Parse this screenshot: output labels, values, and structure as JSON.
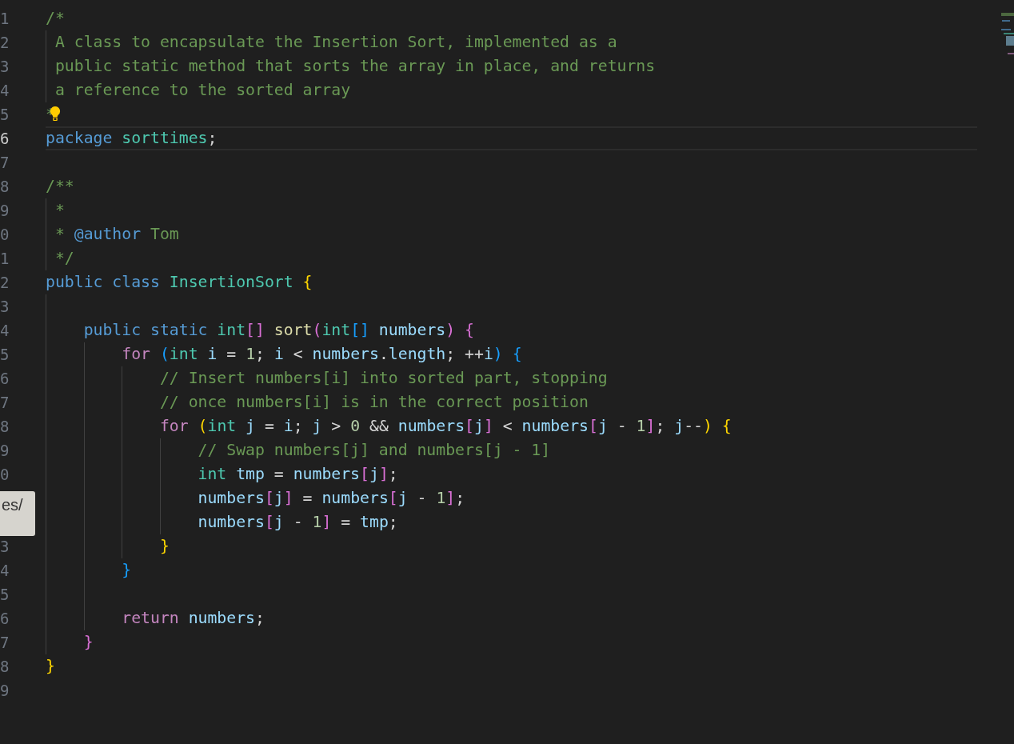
{
  "editor": {
    "lines": [
      {
        "number": "1",
        "current": false,
        "tokens": [
          {
            "kind": "comment",
            "text": "/*"
          }
        ],
        "children": [
          {
            "number": "2",
            "current": false,
            "tokens": [
              {
                "kind": "comment",
                "text": "A class to encapsulate the Insertion Sort, implemented as a"
              }
            ]
          },
          {
            "number": "3",
            "current": false,
            "tokens": [
              {
                "kind": "comment",
                "text": "public static method that sorts the array in place, and returns"
              }
            ]
          },
          {
            "number": "4",
            "current": false,
            "tokens": [
              {
                "kind": "comment",
                "text": "a reference to the sorted array"
              }
            ]
          }
        ]
      },
      {
        "number": "5",
        "current": false,
        "lightbulb": true,
        "tokens": [
          {
            "kind": "comment",
            "text": "*"
          }
        ]
      },
      {
        "number": "6",
        "current": true,
        "tokens": [
          {
            "kind": "keyword",
            "text": "package "
          },
          {
            "kind": "type",
            "text": "sorttimes"
          },
          {
            "kind": "plain",
            "text": ";"
          }
        ]
      },
      {
        "number": "7",
        "current": false
      },
      {
        "number": "8",
        "current": false,
        "tokens": [
          {
            "kind": "comment",
            "text": "/**"
          }
        ],
        "children": [
          {
            "number": "9",
            "current": false,
            "tokens": [
              {
                "kind": "comment",
                "text": "*"
              }
            ]
          },
          {
            "number": "0",
            "current": false,
            "tokens": [
              {
                "kind": "comment",
                "text": "* "
              },
              {
                "kind": "keyword",
                "text": "@author"
              },
              {
                "kind": "comment",
                "text": " Tom"
              }
            ]
          },
          {
            "number": "1",
            "current": false,
            "tokens": [
              {
                "kind": "comment",
                "text": "*/"
              }
            ]
          }
        ]
      },
      {
        "number": "2",
        "current": false,
        "tokens": [
          {
            "kind": "keyword",
            "text": "public class "
          },
          {
            "kind": "type",
            "text": "InsertionSort"
          },
          {
            "kind": "b1",
            "text": " {"
          }
        ],
        "children": [
          {
            "number": "3",
            "current": false
          },
          {
            "number": "4",
            "current": false,
            "tokens": [
              {
                "kind": "keyword",
                "text": "public static "
              },
              {
                "kind": "type",
                "text": "int"
              },
              {
                "kind": "b2",
                "text": "[]"
              },
              {
                "kind": "function",
                "text": " sort"
              },
              {
                "kind": "b2",
                "text": "("
              },
              {
                "kind": "type",
                "text": "int"
              },
              {
                "kind": "b3",
                "text": "[]"
              },
              {
                "kind": "variable",
                "text": " numbers"
              },
              {
                "kind": "b2",
                "text": ")"
              },
              {
                "kind": "b2",
                "text": " {"
              }
            ],
            "children": [
              {
                "number": "5",
                "current": false,
                "tokens": [
                  {
                    "kind": "control",
                    "text": "for "
                  },
                  {
                    "kind": "b3",
                    "text": "("
                  },
                  {
                    "kind": "type",
                    "text": "int"
                  },
                  {
                    "kind": "variable",
                    "text": " i"
                  },
                  {
                    "kind": "plain",
                    "text": " = "
                  },
                  {
                    "kind": "number",
                    "text": "1"
                  },
                  {
                    "kind": "plain",
                    "text": "; "
                  },
                  {
                    "kind": "variable",
                    "text": "i"
                  },
                  {
                    "kind": "plain",
                    "text": " < "
                  },
                  {
                    "kind": "variable",
                    "text": "numbers"
                  },
                  {
                    "kind": "plain",
                    "text": "."
                  },
                  {
                    "kind": "variable",
                    "text": "length"
                  },
                  {
                    "kind": "plain",
                    "text": "; ++"
                  },
                  {
                    "kind": "variable",
                    "text": "i"
                  },
                  {
                    "kind": "b3",
                    "text": ")"
                  },
                  {
                    "kind": "b3",
                    "text": " {"
                  }
                ],
                "children": [
                  {
                    "number": "6",
                    "current": false,
                    "tokens": [
                      {
                        "kind": "comment",
                        "text": "// Insert numbers[i] into sorted part, stopping"
                      }
                    ]
                  },
                  {
                    "number": "7",
                    "current": false,
                    "tokens": [
                      {
                        "kind": "comment",
                        "text": "// once numbers[i] is in the correct position"
                      }
                    ]
                  },
                  {
                    "number": "8",
                    "current": false,
                    "tokens": [
                      {
                        "kind": "control",
                        "text": "for "
                      },
                      {
                        "kind": "b1",
                        "text": "("
                      },
                      {
                        "kind": "type",
                        "text": "int"
                      },
                      {
                        "kind": "variable",
                        "text": " j"
                      },
                      {
                        "kind": "plain",
                        "text": " = "
                      },
                      {
                        "kind": "variable",
                        "text": "i"
                      },
                      {
                        "kind": "plain",
                        "text": "; "
                      },
                      {
                        "kind": "variable",
                        "text": "j"
                      },
                      {
                        "kind": "plain",
                        "text": " > "
                      },
                      {
                        "kind": "number",
                        "text": "0"
                      },
                      {
                        "kind": "plain",
                        "text": " && "
                      },
                      {
                        "kind": "variable",
                        "text": "numbers"
                      },
                      {
                        "kind": "b2",
                        "text": "["
                      },
                      {
                        "kind": "variable",
                        "text": "j"
                      },
                      {
                        "kind": "b2",
                        "text": "]"
                      },
                      {
                        "kind": "plain",
                        "text": " < "
                      },
                      {
                        "kind": "variable",
                        "text": "numbers"
                      },
                      {
                        "kind": "b2",
                        "text": "["
                      },
                      {
                        "kind": "variable",
                        "text": "j"
                      },
                      {
                        "kind": "plain",
                        "text": " - "
                      },
                      {
                        "kind": "number",
                        "text": "1"
                      },
                      {
                        "kind": "b2",
                        "text": "]"
                      },
                      {
                        "kind": "plain",
                        "text": "; "
                      },
                      {
                        "kind": "variable",
                        "text": "j"
                      },
                      {
                        "kind": "plain",
                        "text": "--"
                      },
                      {
                        "kind": "b1",
                        "text": ")"
                      },
                      {
                        "kind": "b1",
                        "text": " {"
                      }
                    ],
                    "children": [
                      {
                        "number": "9",
                        "current": false,
                        "tokens": [
                          {
                            "kind": "comment",
                            "text": "// Swap numbers[j] and numbers[j - 1]"
                          }
                        ]
                      },
                      {
                        "number": "0",
                        "current": false,
                        "tokens": [
                          {
                            "kind": "type",
                            "text": "int"
                          },
                          {
                            "kind": "variable",
                            "text": " tmp"
                          },
                          {
                            "kind": "plain",
                            "text": " = "
                          },
                          {
                            "kind": "variable",
                            "text": "numbers"
                          },
                          {
                            "kind": "b2",
                            "text": "["
                          },
                          {
                            "kind": "variable",
                            "text": "j"
                          },
                          {
                            "kind": "b2",
                            "text": "]"
                          },
                          {
                            "kind": "plain",
                            "text": ";"
                          }
                        ]
                      },
                      {
                        "tokens": [
                          {
                            "kind": "variable",
                            "text": "numbers"
                          },
                          {
                            "kind": "b2",
                            "text": "["
                          },
                          {
                            "kind": "variable",
                            "text": "j"
                          },
                          {
                            "kind": "b2",
                            "text": "]"
                          },
                          {
                            "kind": "plain",
                            "text": " = "
                          },
                          {
                            "kind": "variable",
                            "text": "numbers"
                          },
                          {
                            "kind": "b2",
                            "text": "["
                          },
                          {
                            "kind": "variable",
                            "text": "j"
                          },
                          {
                            "kind": "plain",
                            "text": " - "
                          },
                          {
                            "kind": "number",
                            "text": "1"
                          },
                          {
                            "kind": "b2",
                            "text": "]"
                          },
                          {
                            "kind": "plain",
                            "text": ";"
                          }
                        ]
                      },
                      {
                        "tokens": [
                          {
                            "kind": "variable",
                            "text": "numbers"
                          },
                          {
                            "kind": "b2",
                            "text": "["
                          },
                          {
                            "kind": "variable",
                            "text": "j"
                          },
                          {
                            "kind": "plain",
                            "text": " - "
                          },
                          {
                            "kind": "number",
                            "text": "1"
                          },
                          {
                            "kind": "b2",
                            "text": "]"
                          },
                          {
                            "kind": "plain",
                            "text": " = "
                          },
                          {
                            "kind": "variable",
                            "text": "tmp"
                          },
                          {
                            "kind": "plain",
                            "text": ";"
                          }
                        ]
                      }
                    ]
                  },
                  {
                    "number": "3",
                    "current": false,
                    "tokens": [
                      {
                        "kind": "b1",
                        "text": "}"
                      }
                    ]
                  }
                ]
              },
              {
                "number": "4",
                "current": false,
                "tokens": [
                  {
                    "kind": "b3",
                    "text": "}"
                  }
                ]
              },
              {
                "number": "5",
                "current": false
              },
              {
                "number": "6",
                "current": false,
                "tokens": [
                  {
                    "kind": "control",
                    "text": "return "
                  },
                  {
                    "kind": "variable",
                    "text": "numbers"
                  },
                  {
                    "kind": "plain",
                    "text": ";"
                  }
                ]
              }
            ]
          },
          {
            "number": "7",
            "current": false,
            "tokens": [
              {
                "kind": "b2",
                "text": "}"
              }
            ]
          }
        ]
      },
      {
        "number": "8",
        "current": false,
        "tokens": [
          {
            "kind": "b1",
            "text": "}"
          }
        ]
      },
      {
        "number": "9",
        "current": false
      }
    ]
  },
  "tooltip": {
    "text": "es/"
  }
}
